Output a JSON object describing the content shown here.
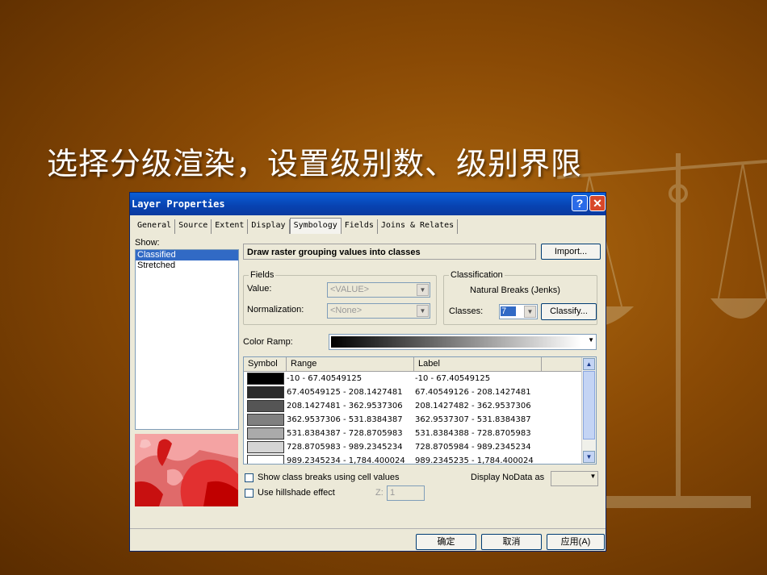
{
  "slide": {
    "title": "选择分级渲染，设置级别数、级别界限"
  },
  "dialog": {
    "title": "Layer Properties",
    "help_label": "?",
    "close_label": "✕",
    "tabs": [
      "General",
      "Source",
      "Extent",
      "Display",
      "Symbology",
      "Fields",
      "Joins & Relates"
    ],
    "active_tab": "Symbology",
    "show": {
      "label": "Show:",
      "items": [
        "Classified",
        "Stretched"
      ],
      "selected": "Classified"
    },
    "header_text": "Draw raster grouping values into classes",
    "import_label": "Import...",
    "fields": {
      "title": "Fields",
      "value_label": "Value:",
      "value": "<VALUE>",
      "normalization_label": "Normalization:",
      "normalization": "<None>"
    },
    "classification": {
      "title": "Classification",
      "method": "Natural Breaks (Jenks)",
      "classes_label": "Classes:",
      "classes": "7",
      "classify_label": "Classify..."
    },
    "color_ramp_label": "Color Ramp:",
    "table": {
      "headers": [
        "Symbol",
        "Range",
        "Label"
      ],
      "rows": [
        {
          "color": "#000000",
          "range": "-10 - 67.40549125",
          "label": "-10 - 67.40549125"
        },
        {
          "color": "#2a2a2a",
          "range": "67.40549125 - 208.1427481",
          "label": "67.40549126 - 208.1427481"
        },
        {
          "color": "#555555",
          "range": "208.1427481 - 362.9537306",
          "label": "208.1427482 - 362.9537306"
        },
        {
          "color": "#808080",
          "range": "362.9537306 - 531.8384387",
          "label": "362.9537307 - 531.8384387"
        },
        {
          "color": "#aaaaaa",
          "range": "531.8384387 - 728.8705983",
          "label": "531.8384388 - 728.8705983"
        },
        {
          "color": "#d4d4d4",
          "range": "728.8705983 - 989.2345234",
          "label": "728.8705984 - 989.2345234"
        },
        {
          "color": "#ffffff",
          "range": "989.2345234 - 1,784.400024",
          "label": "989.2345235 - 1,784.400024"
        }
      ]
    },
    "show_breaks_label": "Show class breaks using cell values",
    "hillshade_label": "Use hillshade effect",
    "z_label": "Z:",
    "z_value": "1",
    "nodata_label": "Display NoData as",
    "buttons": {
      "ok": "确定",
      "cancel": "取消",
      "apply": "应用(A)"
    }
  }
}
